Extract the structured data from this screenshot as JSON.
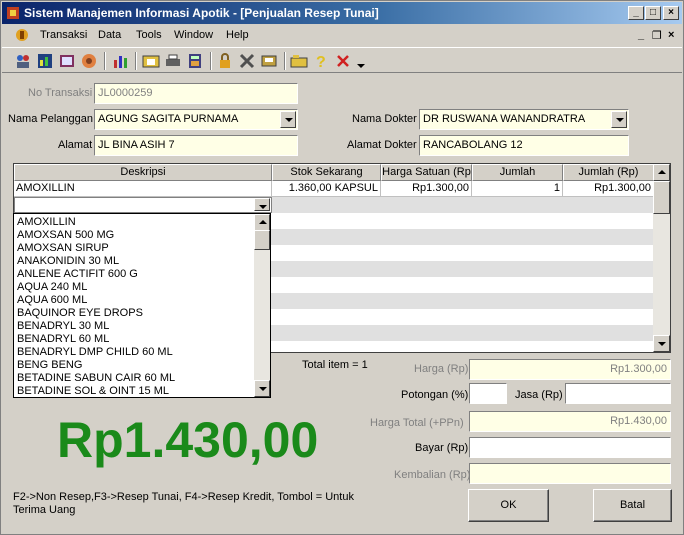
{
  "window": {
    "title": "Sistem Manajemen Informasi Apotik - [Penjualan Resep Tunai]",
    "minimize": "_",
    "maximize": "□",
    "close": "×"
  },
  "menu": {
    "items": [
      "Transaksi",
      "Data",
      "Tools",
      "Window",
      "Help"
    ],
    "mdi_minimize": "_",
    "mdi_restore": "❐",
    "mdi_close": "×"
  },
  "toolbar": {
    "icons": [
      "users-icon",
      "chart-icon",
      "report-icon",
      "hand-icon",
      "bar-chart-icon",
      "folder-icon",
      "printer-icon",
      "calculator-icon",
      "lock-icon",
      "tools-icon",
      "backup-icon",
      "open-folder-icon",
      "help-icon",
      "close-x-icon",
      "more-arrow-icon"
    ]
  },
  "form": {
    "no_transaksi_label": "No Transaksi",
    "no_transaksi_value": "JL0000259",
    "nama_pelanggan_label": "Nama Pelanggan",
    "nama_pelanggan_value": "AGUNG SAGITA PURNAMA",
    "alamat_label": "Alamat",
    "alamat_value": "JL BINA ASIH 7",
    "nama_dokter_label": "Nama Dokter",
    "nama_dokter_value": "DR RUSWANA WANANDRATRA",
    "alamat_dokter_label": "Alamat Dokter",
    "alamat_dokter_value": "RANCABOLANG 12"
  },
  "grid": {
    "headers": [
      "Deskripsi",
      "Stok Sekarang",
      "Harga Satuan (Rp",
      "Jumlah",
      "Jumlah (Rp)"
    ],
    "rows": [
      {
        "deskripsi": "AMOXILLIN",
        "stok": "1.360,00 KAPSUL",
        "harga": "Rp1.300,00",
        "jumlah": "1",
        "jumlah_rp": "Rp1.300,00"
      }
    ]
  },
  "dropdown": {
    "items": [
      "AMOXILLIN",
      "AMOXSAN 500 MG",
      "AMOXSAN SIRUP",
      "ANAKONIDIN 30 ML",
      "ANLENE ACTIFIT 600 G",
      "AQUA 240 ML",
      "AQUA 600 ML",
      "BAQUINOR EYE DROPS",
      "BENADRYL 30 ML",
      "BENADRYL 60 ML",
      "BENADRYL DMP CHILD 60 ML",
      "BENG BENG",
      "BETADINE SABUN CAIR 60 ML",
      "BETADINE SOL & OINT 15 ML"
    ]
  },
  "summary": {
    "total_item": "Total item = 1",
    "harga_label": "Harga (Rp)",
    "harga_value": "Rp1.300,00",
    "potongan_label": "Potongan (%)",
    "potongan_value": "",
    "jasa_label": "Jasa (Rp)",
    "jasa_value": "",
    "harga_total_label": "Harga Total  (+PPn)",
    "harga_total_value": "Rp1.430,00",
    "bayar_label": "Bayar (Rp)",
    "bayar_value": "",
    "kembalian_label": "Kembalian (Rp)",
    "kembalian_value": "",
    "big_total": "Rp1.430,00",
    "hint": "F2->Non Resep,F3->Resep Tunai, F4->Resep Kredit, Tombol = Untuk Terima Uang"
  },
  "buttons": {
    "ok": "OK",
    "batal": "Batal"
  },
  "colors": {
    "title_gradient_start": "#0a246a",
    "big_total": "#1a8a1a",
    "field_bg": "#ffffe6"
  }
}
